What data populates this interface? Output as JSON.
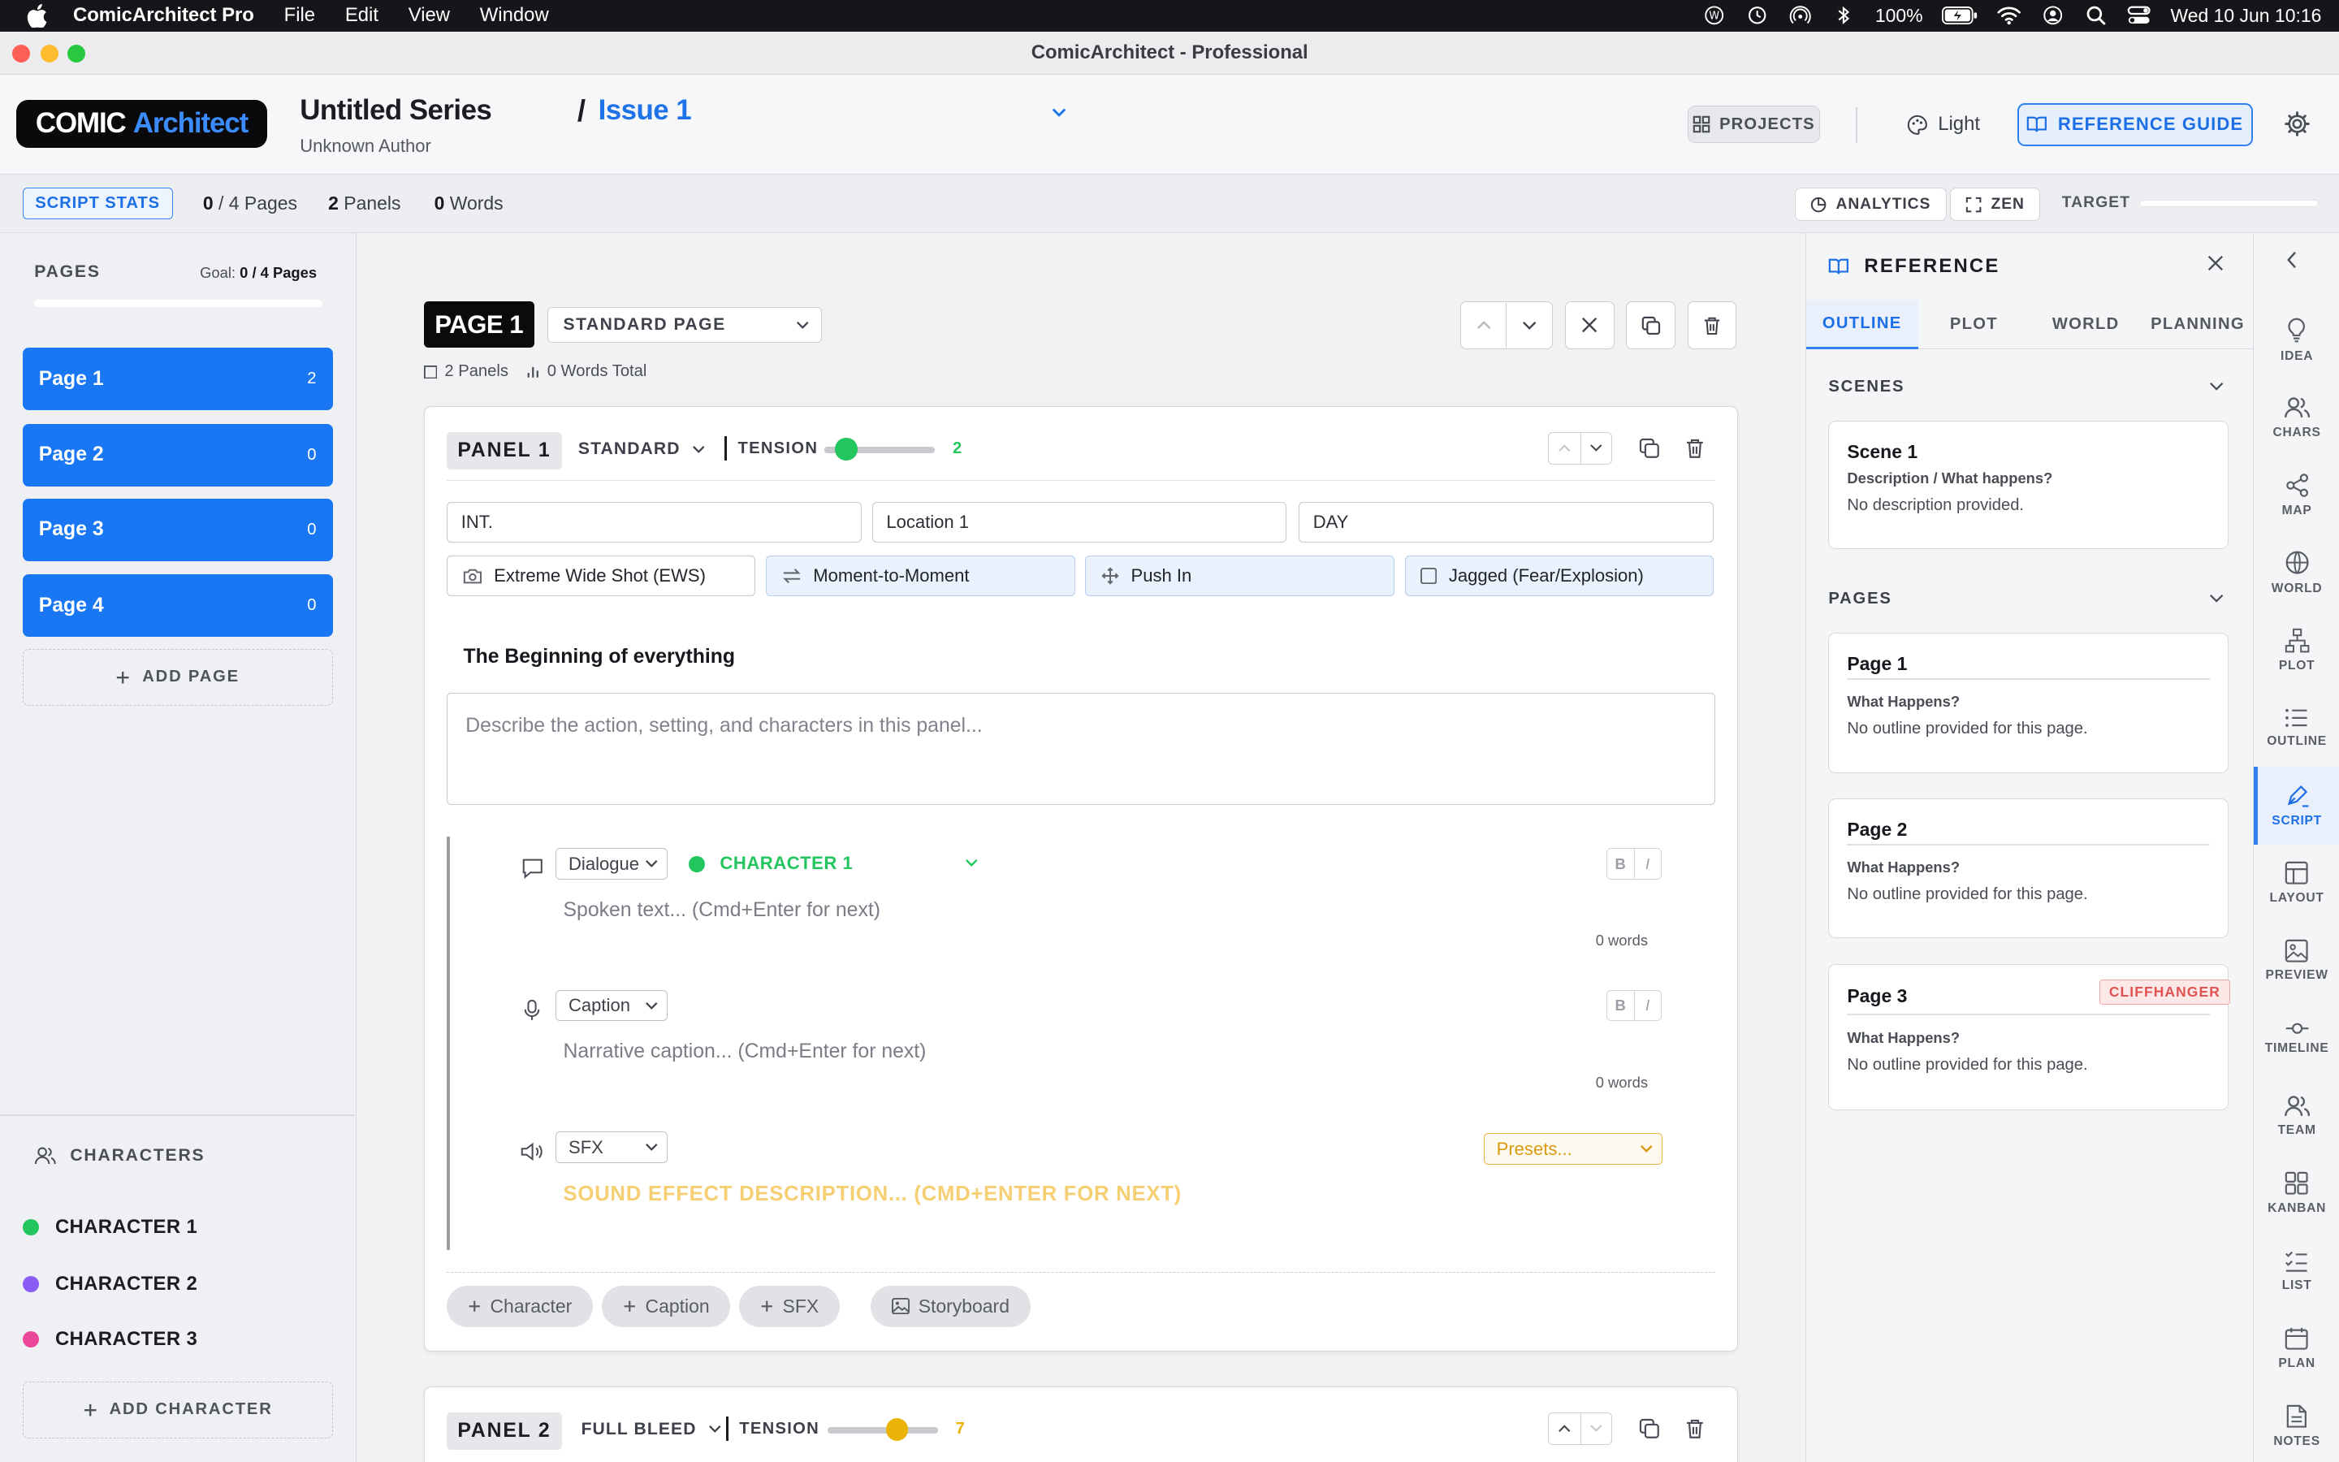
{
  "menubar": {
    "app_name": "ComicArchitect Pro",
    "menus": [
      "File",
      "Edit",
      "View",
      "Window"
    ],
    "battery": "100%",
    "datetime": "Wed 10 Jun  10:16"
  },
  "window": {
    "title": "ComicArchitect - Professional"
  },
  "header": {
    "logo_a": "COMIC",
    "logo_b": "Architect",
    "series_title": "Untitled Series",
    "author": "Unknown Author",
    "separator": "/",
    "issue": "Issue 1",
    "projects_label": "PROJECTS",
    "theme_label": "Light",
    "reference_guide_label": "REFERENCE GUIDE"
  },
  "stats": {
    "label": "SCRIPT STATS",
    "pages_done": "0",
    "pages_total_text": "/ 4 Pages",
    "panels_count": "2",
    "panels_label": "Panels",
    "words_count": "0",
    "words_label": "Words",
    "analytics_label": "ANALYTICS",
    "zen_label": "ZEN",
    "target_label": "TARGET"
  },
  "sidebar": {
    "pages_heading": "PAGES",
    "goal_label": "Goal:",
    "goal_value": "0 / 4 Pages",
    "pages": [
      {
        "label": "Page 1",
        "count": "2"
      },
      {
        "label": "Page 2",
        "count": "0"
      },
      {
        "label": "Page 3",
        "count": "0"
      },
      {
        "label": "Page 4",
        "count": "0"
      }
    ],
    "add_page_label": "ADD PAGE",
    "characters_heading": "CHARACTERS",
    "characters": [
      {
        "name": "CHARACTER 1",
        "color": "#22c55e"
      },
      {
        "name": "CHARACTER 2",
        "color": "#8b5cf6"
      },
      {
        "name": "CHARACTER 3",
        "color": "#ec4899"
      }
    ],
    "add_character_label": "ADD CHARACTER"
  },
  "editor": {
    "page_badge": "PAGE 1",
    "page_type": "STANDARD PAGE",
    "panels_meta": "2 Panels",
    "words_meta": "0 Words Total",
    "panel1": {
      "badge": "PANEL 1",
      "type": "STANDARD",
      "tension_label": "TENSION",
      "tension_value": "2",
      "tension_fraction": 0.2,
      "int_ext": "INT.",
      "location": "Location 1",
      "time": "DAY",
      "shot": "Extreme Wide Shot (EWS)",
      "transition": "Moment-to-Moment",
      "camera_move": "Push In",
      "border": "Jagged (Fear/Explosion)",
      "beat_title": "The Beginning of everything",
      "description_placeholder": "Describe the action, setting, and characters in this panel...",
      "dialogue_type": "Dialogue",
      "dialogue_character": "CHARACTER 1",
      "dialogue_placeholder": "Spoken text... (Cmd+Enter for next)",
      "dialogue_words": "0 words",
      "caption_type": "Caption",
      "caption_placeholder": "Narrative caption... (Cmd+Enter for next)",
      "caption_words": "0 words",
      "sfx_type": "SFX",
      "sfx_presets": "Presets...",
      "sfx_placeholder": "SOUND EFFECT DESCRIPTION... (CMD+ENTER FOR NEXT)",
      "bold": "B",
      "italic": "I",
      "add_character": "Character",
      "add_caption": "Caption",
      "add_sfx": "SFX",
      "storyboard": "Storyboard"
    },
    "panel2": {
      "badge": "PANEL 2",
      "type": "FULL BLEED",
      "tension_label": "TENSION",
      "tension_value": "7",
      "tension_fraction": 0.63
    }
  },
  "reference": {
    "title": "REFERENCE",
    "tabs": [
      "OUTLINE",
      "PLOT",
      "WORLD",
      "PLANNING"
    ],
    "scenes_heading": "SCENES",
    "scene": {
      "title": "Scene 1",
      "subtitle": "Description / What happens?",
      "note": "No description provided."
    },
    "pages_heading": "PAGES",
    "pages": [
      {
        "title": "Page 1",
        "subtitle": "What Happens?",
        "note": "No outline provided for this page.",
        "badge": ""
      },
      {
        "title": "Page 2",
        "subtitle": "What Happens?",
        "note": "No outline provided for this page.",
        "badge": ""
      },
      {
        "title": "Page 3",
        "subtitle": "What Happens?",
        "note": "No outline provided for this page.",
        "badge": "CLIFFHANGER"
      }
    ]
  },
  "rail": {
    "items": [
      "IDEA",
      "CHARS",
      "MAP",
      "WORLD",
      "PLOT",
      "OUTLINE",
      "SCRIPT",
      "LAYOUT",
      "PREVIEW",
      "TIMELINE",
      "TEAM",
      "KANBAN",
      "LIST",
      "PLAN",
      "NOTES"
    ]
  },
  "colors": {
    "accent": "#1977f3",
    "tension_low": "#22c55e",
    "tension_mid": "#eab308",
    "sfx": "#f6cf72"
  }
}
